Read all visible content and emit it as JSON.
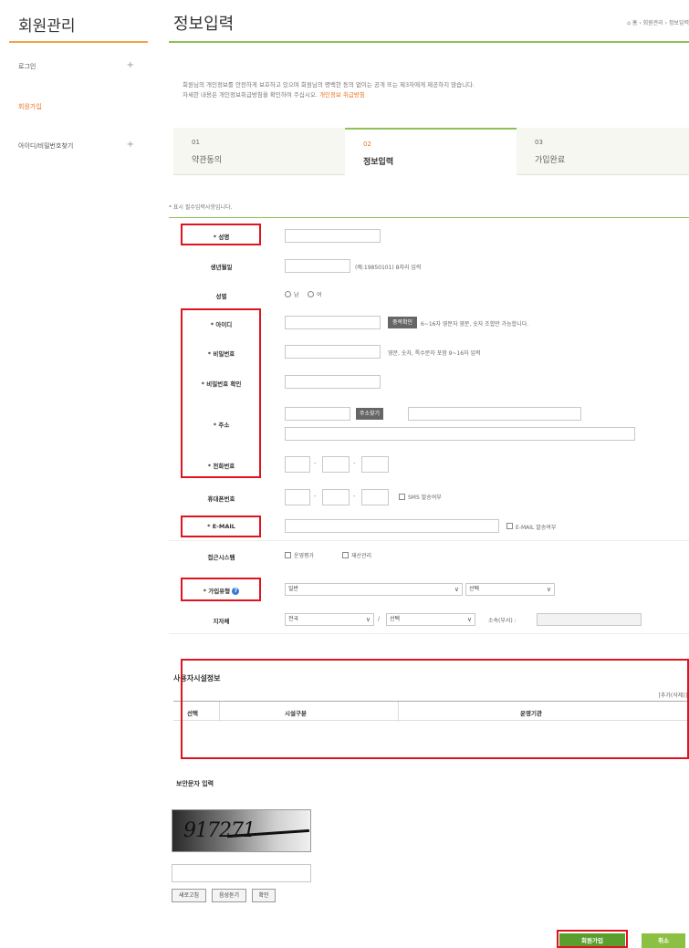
{
  "sidebar": {
    "title": "회원관리",
    "items": [
      {
        "label": "로그인",
        "plus": "+"
      },
      {
        "label": "회원가입",
        "plus": ""
      },
      {
        "label": "아이디/비밀번호찾기",
        "plus": "+"
      }
    ]
  },
  "header": {
    "title": "정보입력",
    "breadcrumb": "⌂ 홈 › 회원관리 › 정보입력"
  },
  "notice": {
    "line1": "회원님의 개인정보를 안전하게 보호하고 있으며 회원님의 명백한 동의 없이는 공개 또는 제3자에게 제공하지 않습니다.",
    "line2": "자세한 내용은 개인정보취급방침을 확인하여 주십시오.",
    "link": "개인정보 취급방침"
  },
  "steps": [
    {
      "num": "01",
      "label": "약관동의"
    },
    {
      "num": "02",
      "label": "정보입력"
    },
    {
      "num": "03",
      "label": "가입완료"
    }
  ],
  "required_note": "* 표시 필수입력사항입니다.",
  "form": {
    "name_label": "* 성명",
    "birth_label": "생년월일",
    "birth_hint": "(예:19850101) 8자리 입력",
    "gender_label": "성별",
    "gender_male": "남",
    "gender_female": "여",
    "id_label": "* 아이디",
    "id_check": "중복확인",
    "id_hint": "6~16자 영문자 영문, 숫자 조합만 가능합니다.",
    "pw_label": "* 비밀번호",
    "pw_hint": "영문, 숫자, 특수문자 포함 9~16자 입력",
    "pw_confirm_label": "* 비밀번호 확인",
    "address_label": "* 주소",
    "address_search": "주소찾기",
    "phone_label": "* 전화번호",
    "mobile_label": "휴대폰번호",
    "sms_label": "SMS 발송여부",
    "email_label": "* E-MAIL",
    "email_send_label": "E-MAIL 발송여부",
    "system_label": "접근시스템",
    "system_opt1": "운영평가",
    "system_opt2": "재산관리",
    "join_type_label": "* 가입유형",
    "join_type_value": "일반",
    "join_type_sub": "선택",
    "region_label": "지자체",
    "region_value": "전국",
    "region_sub": "선택",
    "region_sep": "/",
    "affiliation_label": "소속(부서) :",
    "dash": "-"
  },
  "facility": {
    "title": "사용자시설정보",
    "add": "[추가(삭제)]",
    "col_select": "선택",
    "col_type": "시설구분",
    "col_operator": "운영기관"
  },
  "captcha": {
    "title": "보안문자 입력",
    "image_text": "917271",
    "btn_refresh": "새로고침",
    "btn_audio": "음성듣기",
    "btn_confirm": "확인"
  },
  "actions": {
    "submit": "회원가입",
    "cancel": "취소"
  },
  "colors": {
    "accent_orange": "#e8731f",
    "accent_green": "#8fbf5a",
    "highlight_red": "#e0141e"
  }
}
